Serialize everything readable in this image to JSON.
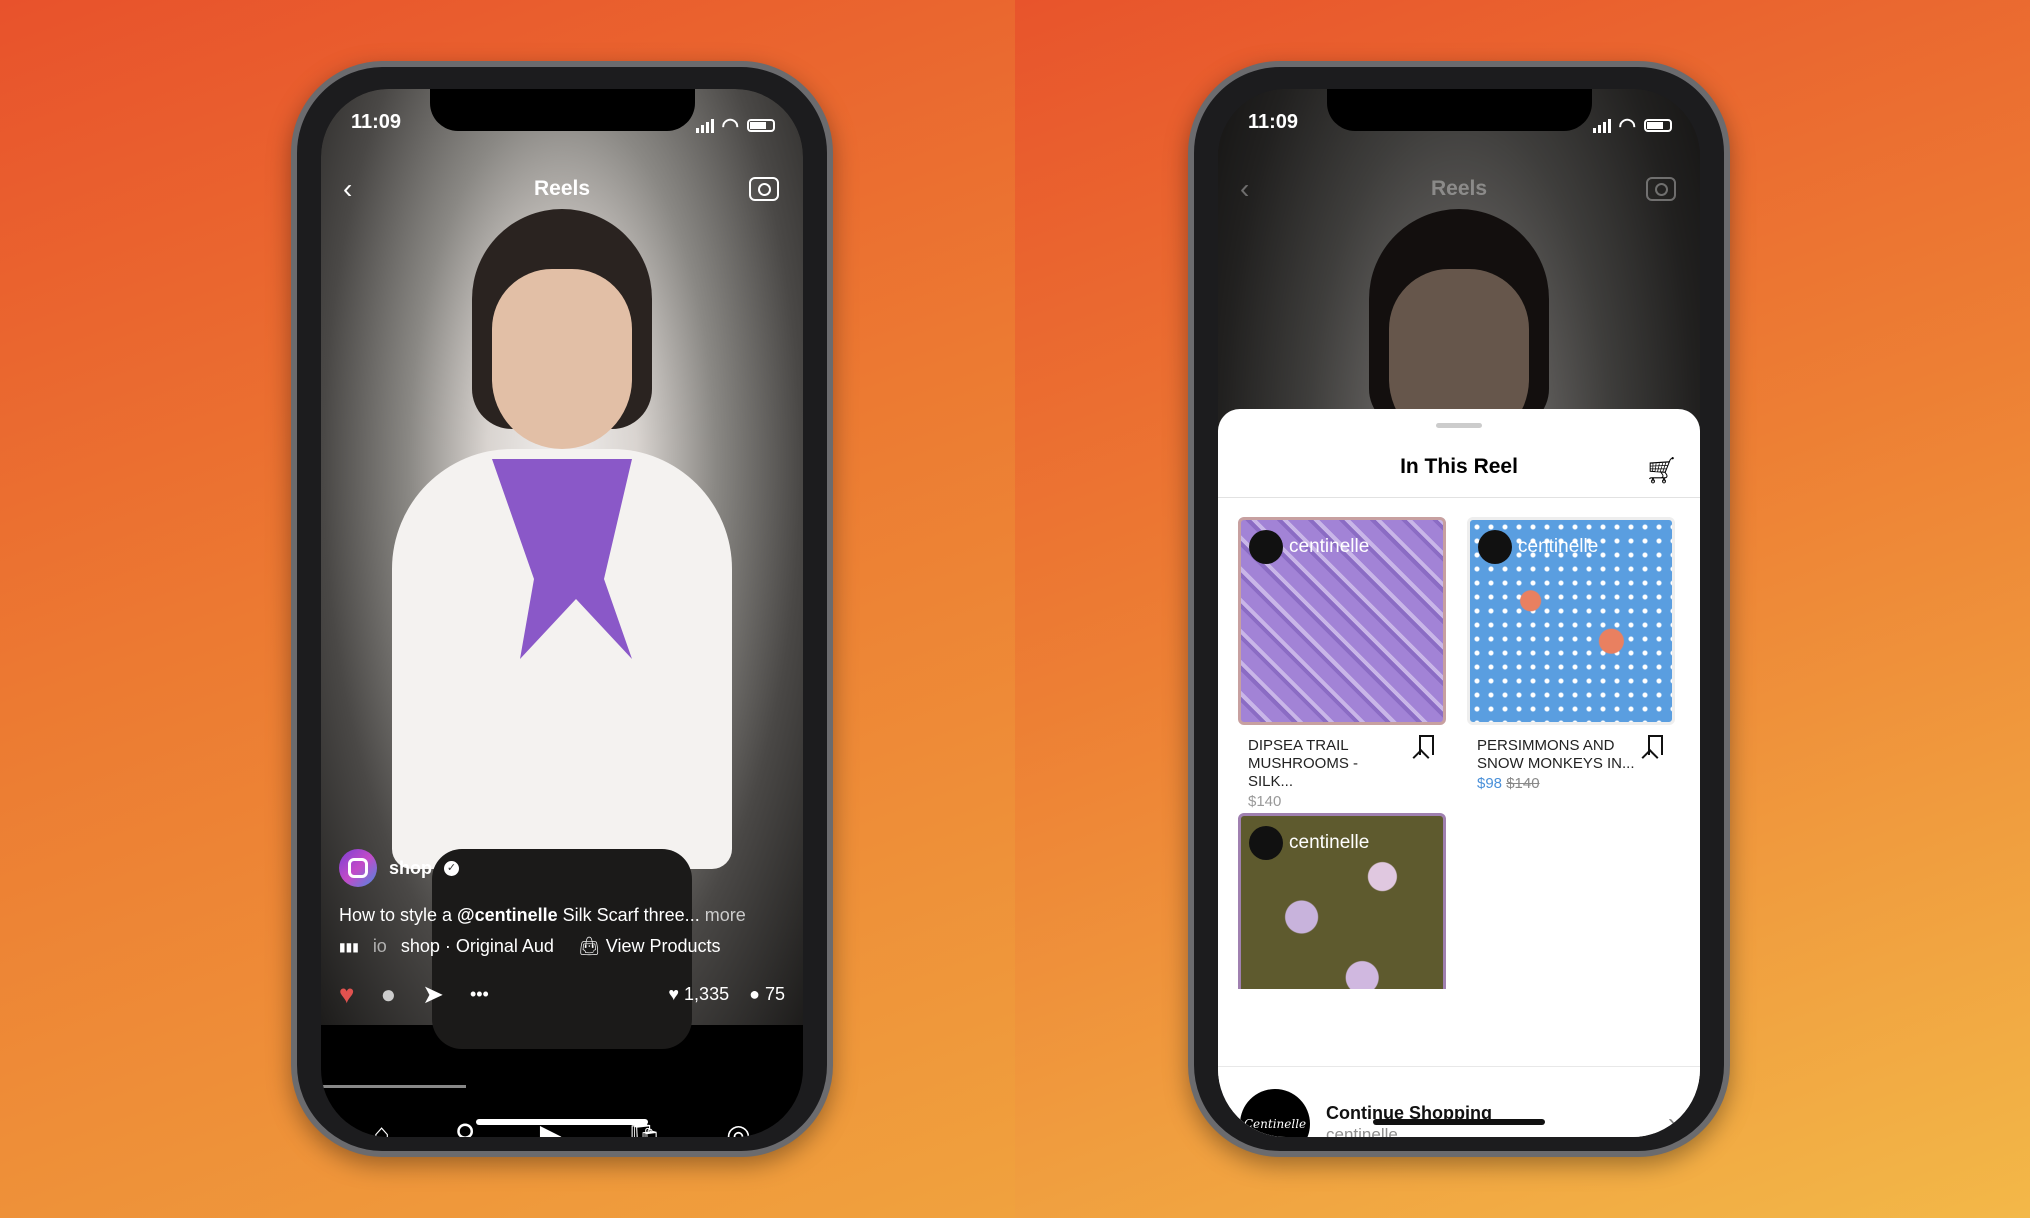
{
  "left_phone": {
    "status": {
      "time": "11:09"
    },
    "header": {
      "title": "Reels",
      "back_icon": "chevron-left-icon",
      "camera_icon": "camera-icon"
    },
    "post": {
      "username": "shop",
      "caption_prefix": "How to style a ",
      "caption_mention": "@centinelle",
      "caption_suffix": " Silk Scarf three...",
      "more_label": "more",
      "audio_prefix": "io",
      "audio_label": "shop · Original Aud",
      "view_products_label": "View Products",
      "likes": "1,335",
      "comments": "75"
    },
    "colors": {
      "like": "#e0524f"
    }
  },
  "right_phone": {
    "status": {
      "time": "11:09"
    },
    "header": {
      "title": "Reels"
    },
    "sheet": {
      "title": "In This Reel",
      "products": [
        {
          "brand": "centinelle",
          "name": "DIPSEA TRAIL MUSHROOMS  - Silk...",
          "price": "$140"
        },
        {
          "brand": "centinelle",
          "name": "PERSIMMONS AND SNOW MONKEYS IN...",
          "sale_price": "$98",
          "original_price": "$140"
        },
        {
          "brand": "centinelle"
        }
      ],
      "footer": {
        "title": "Continue Shopping",
        "subtitle": "centinelle",
        "logo_text": "Centinelle"
      }
    },
    "colors": {
      "sale": "#4a90d9"
    }
  }
}
